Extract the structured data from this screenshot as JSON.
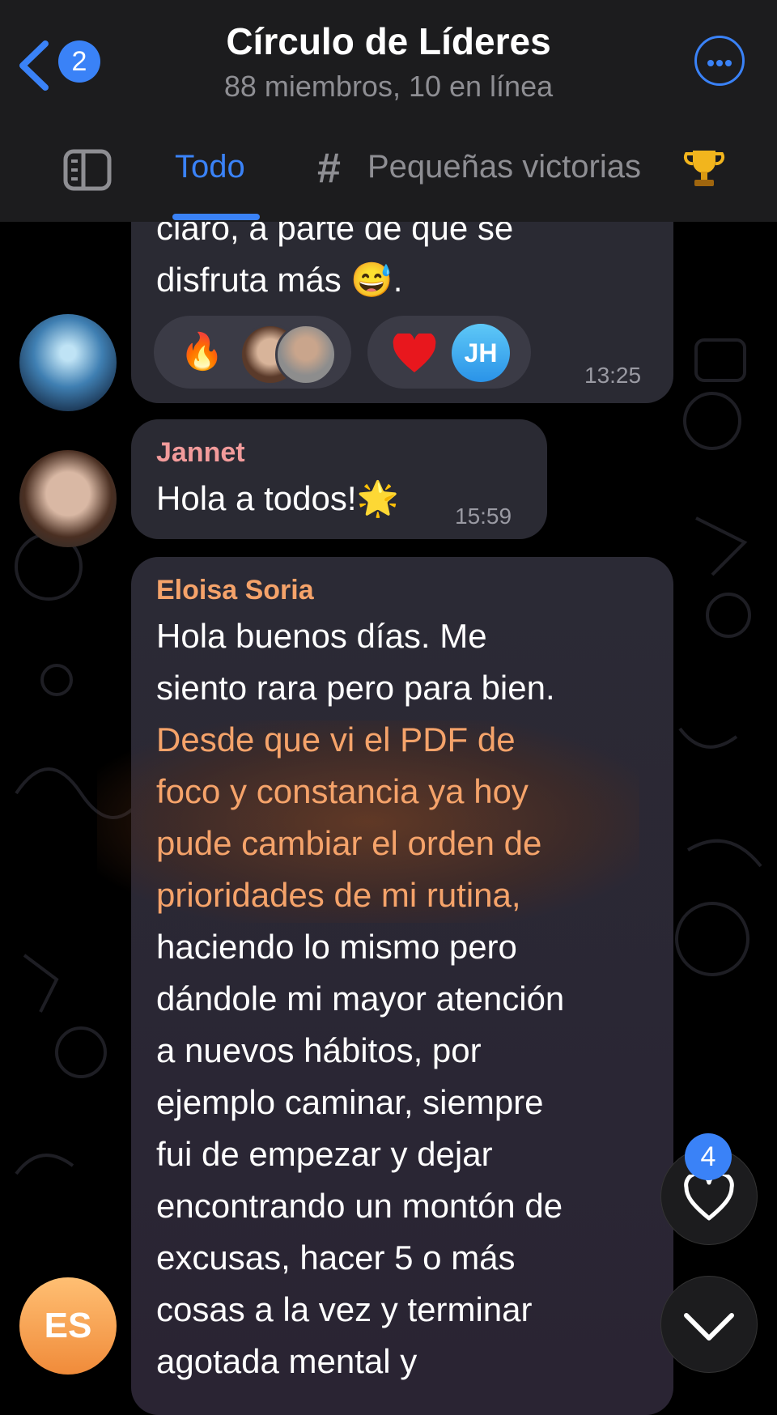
{
  "header": {
    "back_badge": "2",
    "title": "Círculo de Líderes",
    "subtitle": "88 miembros, 10 en línea"
  },
  "tabs": {
    "active": "Todo",
    "topic": "Pequeñas victorias",
    "topic_icon": "trophy-icon"
  },
  "messages": {
    "prev": {
      "line1": "claro, a parte de que se",
      "line2": "disfruta más",
      "emoji": "😅",
      "line2_end": ".",
      "reactions": [
        {
          "emoji": "🔥",
          "icon": "fire-reaction"
        },
        {
          "emoji": "❤️",
          "icon": "heart-reaction",
          "user_initials": "JH"
        }
      ],
      "time": "13:25"
    },
    "jannet": {
      "sender": "Jannet",
      "sender_color": "#f29b9b",
      "text": "Hola a todos!",
      "emoji": "🌟",
      "time": "15:59"
    },
    "eloisa": {
      "sender": "Eloisa Soria",
      "sender_color": "#f5a36a",
      "lines": [
        "Hola buenos días. Me",
        "siento rara pero para bien."
      ],
      "highlight_lines": [
        "Desde que vi el PDF de",
        "foco y constancia ya hoy",
        "pude cambiar el orden de",
        "prioridades de mi rutina,"
      ],
      "rest_lines": [
        "haciendo lo mismo pero",
        "dándole mi mayor atención",
        "a nuevos hábitos, por",
        "ejemplo caminar, siempre",
        "fui de empezar y dejar",
        "encontrando un montón de",
        "excusas, hacer 5 o más",
        "cosas a la vez y terminar",
        "agotada mental y"
      ]
    }
  },
  "fab": {
    "reactions_badge": "4"
  },
  "composer_avatar": "ES",
  "colors": {
    "accent": "#3a82f7",
    "bubble": "#2a2a33",
    "highlight_text": "#f5a36a"
  }
}
